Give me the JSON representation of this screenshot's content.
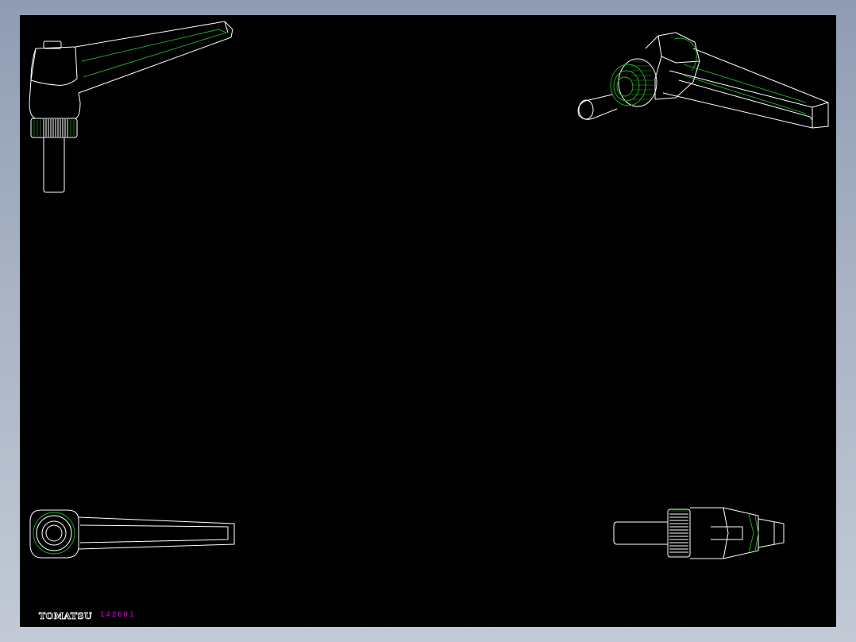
{
  "drawing": {
    "brand": "TOMATSU",
    "code": "142601",
    "colors": {
      "background": "#000000",
      "frame": "#a9b3c4",
      "line": "#ffffff",
      "hidden_line": "#1fb81f",
      "code_text": "#e600e6"
    }
  }
}
